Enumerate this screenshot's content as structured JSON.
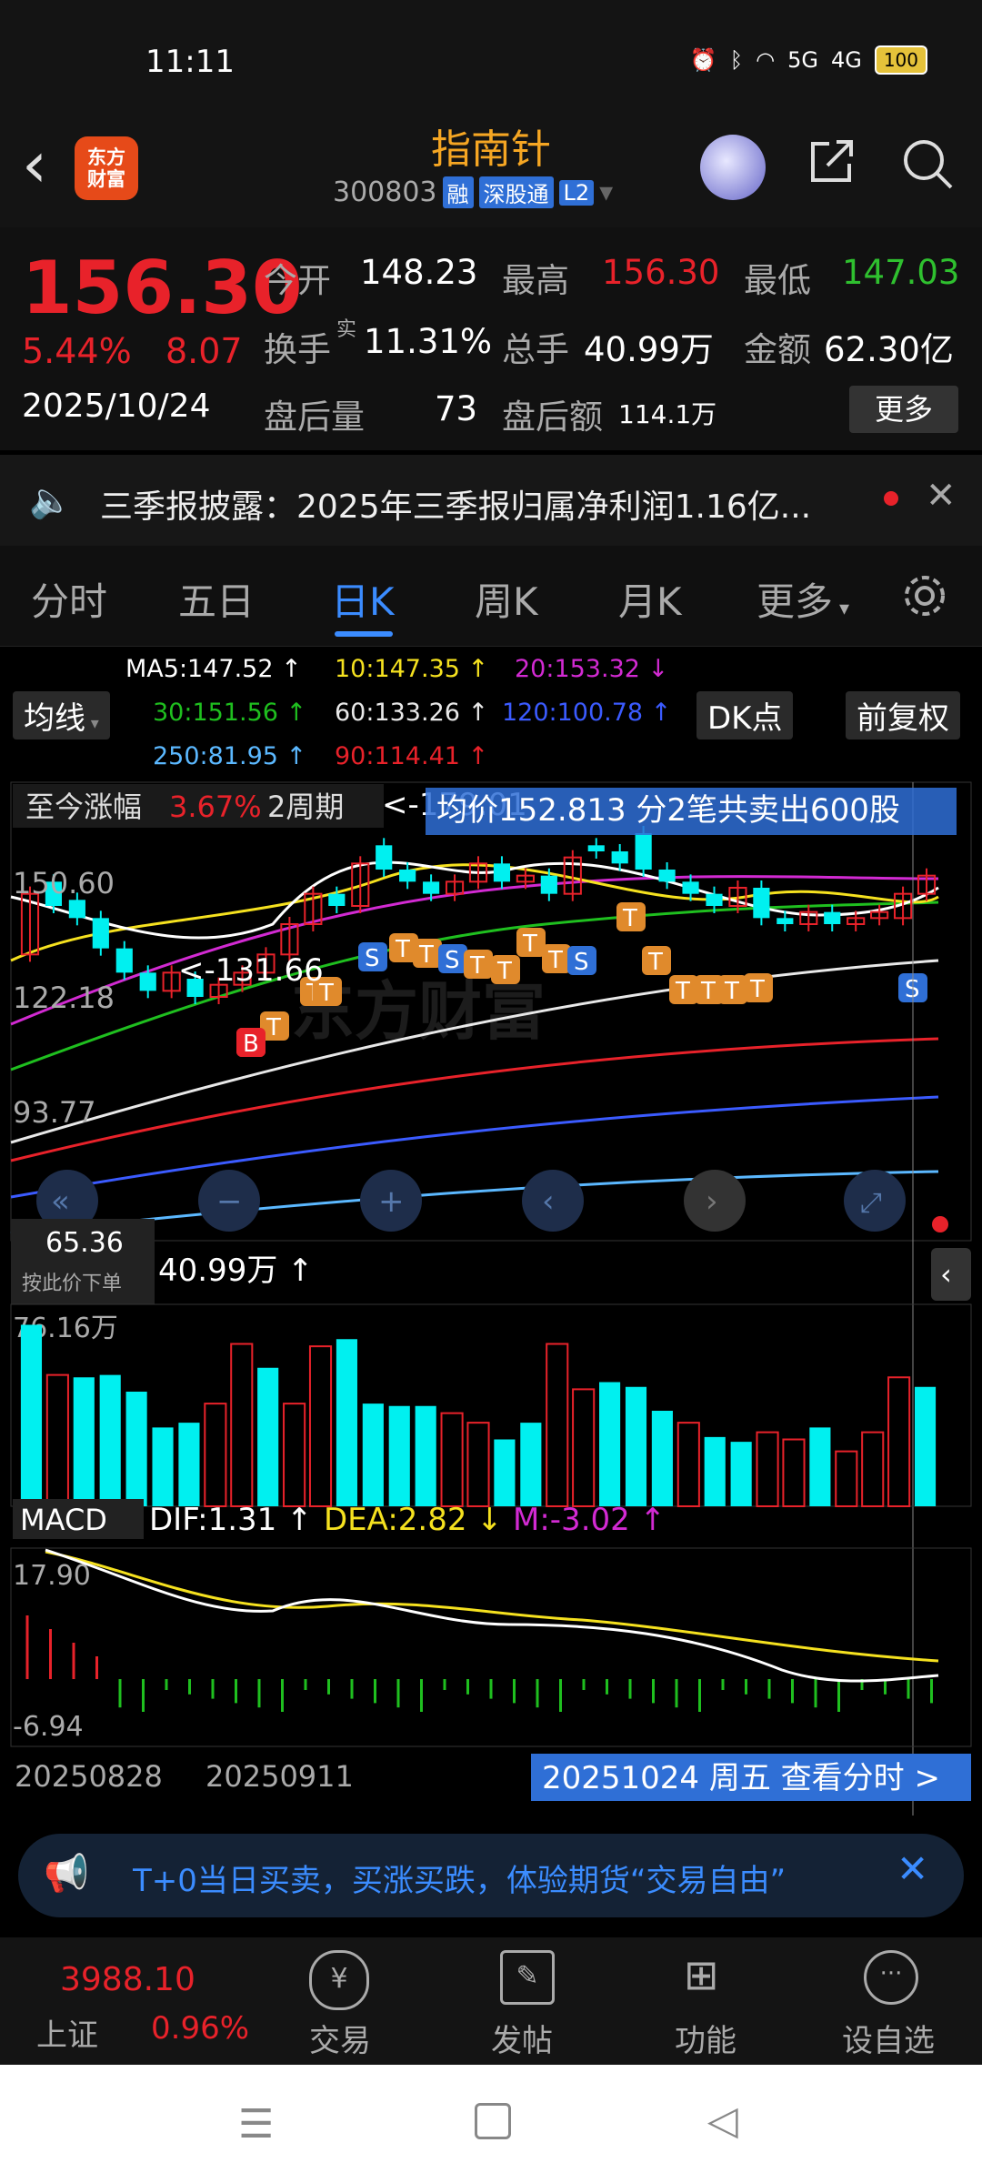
{
  "status_bar": {
    "time": "11:11",
    "network_5g": "5G",
    "network_4g": "4G",
    "battery": "100"
  },
  "header": {
    "logo_line1": "东方",
    "logo_line2": "财富",
    "stock_name": "指南针",
    "stock_code": "300803",
    "tags": [
      "融",
      "深股通",
      "L2"
    ]
  },
  "quote": {
    "price": "156.30",
    "change_pct": "5.44%",
    "change": "8.07",
    "date": "2025/10/24",
    "open_label": "今开",
    "open": "148.23",
    "high_label": "最高",
    "high": "156.30",
    "low_label": "最低",
    "low": "147.03",
    "turnover_label": "换手",
    "turnover_sup": "实",
    "turnover": "11.31%",
    "volume_label": "总手",
    "volume": "40.99万",
    "amount_label": "金额",
    "amount": "62.30亿",
    "after_vol_label": "盘后量",
    "after_vol": "73",
    "after_amt_label": "盘后额",
    "after_amt": "114.1万",
    "more_label": "更多"
  },
  "news": {
    "text": "三季报披露：2025年三季报归属净利润1.16亿..."
  },
  "tabs": [
    "分时",
    "五日",
    "日K",
    "周K",
    "月K",
    "更多"
  ],
  "active_tab": "日K",
  "chart": {
    "ma_button": "均线",
    "ma_values": {
      "ma5": "MA5:147.52 ↑",
      "ma10": "10:147.35 ↑",
      "ma20": "20:153.32 ↓",
      "ma30": "30:151.56 ↑",
      "ma60": "60:133.26 ↑",
      "ma120": "120:100.78 ↑",
      "ma250": "250:81.95 ↑",
      "ma90": "90:114.41 ↑"
    },
    "dk_button": "DK点",
    "adjust_button": "前复权",
    "gain_label": "至今涨幅",
    "gain_value": "3.67%",
    "period": "2周期",
    "high_mark": "<-179.01",
    "low_mark": "<-131.66",
    "avg_banner": "均价152.813  分2笔共卖出600股",
    "y_labels": [
      "150.60",
      "122.18",
      "93.77"
    ],
    "cursor_price": "65.36",
    "order_hint": "按此价下单",
    "volume_label": "40.99万 ↑",
    "volume_max": "76.16万",
    "macd_label": "MACD",
    "dif": "DIF:1.31 ↑",
    "dea": "DEA:2.82 ↓",
    "m": "M:-3.02 ↑",
    "macd_top": "17.90",
    "macd_bottom": "-6.94",
    "dates": [
      "20250828",
      "20250911"
    ],
    "view_link": "20251024 周五 查看分时 >",
    "colors": {
      "up": "#e8222a",
      "down": "#00f0f0",
      "ma5": "#ffffff",
      "ma10": "#f5e11f",
      "ma20": "#d22ad2",
      "ma30": "#1fbf1f",
      "ma60": "#e8e8e8",
      "ma90": "#e8222a",
      "ma120": "#3b5bff",
      "ma250": "#5bb8ff"
    }
  },
  "chart_data": {
    "type": "candlestick",
    "candles": [
      {
        "o": 140,
        "c": 150,
        "up": true
      },
      {
        "o": 152,
        "c": 148,
        "up": false
      },
      {
        "o": 149,
        "c": 146,
        "up": false
      },
      {
        "o": 146,
        "c": 141,
        "up": false
      },
      {
        "o": 141,
        "c": 137,
        "up": false
      },
      {
        "o": 137,
        "c": 134,
        "up": false
      },
      {
        "o": 134,
        "c": 137,
        "up": true
      },
      {
        "o": 136,
        "c": 133,
        "up": false
      },
      {
        "o": 133,
        "c": 135,
        "up": true
      },
      {
        "o": 135,
        "c": 137,
        "up": true
      },
      {
        "o": 137,
        "c": 140,
        "up": true
      },
      {
        "o": 140,
        "c": 145,
        "up": true
      },
      {
        "o": 145,
        "c": 150,
        "up": true
      },
      {
        "o": 150,
        "c": 148,
        "up": false
      },
      {
        "o": 148,
        "c": 155,
        "up": true
      },
      {
        "o": 158,
        "c": 154,
        "up": false
      },
      {
        "o": 154,
        "c": 152,
        "up": false
      },
      {
        "o": 152,
        "c": 150,
        "up": false
      },
      {
        "o": 150,
        "c": 152,
        "up": true
      },
      {
        "o": 152,
        "c": 155,
        "up": true
      },
      {
        "o": 155,
        "c": 152,
        "up": false
      },
      {
        "o": 152,
        "c": 153,
        "up": true
      },
      {
        "o": 153,
        "c": 150,
        "up": false
      },
      {
        "o": 150,
        "c": 156,
        "up": true
      },
      {
        "o": 158,
        "c": 157,
        "up": false
      },
      {
        "o": 157,
        "c": 155,
        "up": false
      },
      {
        "o": 160,
        "c": 154,
        "up": false
      },
      {
        "o": 154,
        "c": 152,
        "up": false
      },
      {
        "o": 152,
        "c": 150,
        "up": false
      },
      {
        "o": 150,
        "c": 148,
        "up": false
      },
      {
        "o": 148,
        "c": 151,
        "up": true
      },
      {
        "o": 151,
        "c": 146,
        "up": false
      },
      {
        "o": 146,
        "c": 145,
        "up": false
      },
      {
        "o": 145,
        "c": 147,
        "up": true
      },
      {
        "o": 147,
        "c": 145,
        "up": false
      },
      {
        "o": 145,
        "c": 146,
        "up": true
      },
      {
        "o": 146,
        "c": 147,
        "up": true
      },
      {
        "o": 146,
        "c": 150,
        "up": true
      },
      {
        "o": 150,
        "c": 153,
        "up": true
      }
    ],
    "volume": [
      76,
      55,
      54,
      55,
      48,
      33,
      35,
      43,
      68,
      58,
      43,
      67,
      70,
      43,
      42,
      42,
      39,
      35,
      28,
      35,
      68,
      49,
      52,
      50,
      40,
      35,
      29,
      27,
      31,
      28,
      33,
      23,
      31,
      54,
      50
    ],
    "volume_up": [
      false,
      true,
      false,
      false,
      false,
      false,
      false,
      true,
      true,
      false,
      true,
      true,
      false,
      false,
      false,
      false,
      true,
      true,
      false,
      false,
      true,
      true,
      false,
      false,
      false,
      true,
      false,
      false,
      true,
      true,
      false,
      true,
      true,
      true,
      false
    ],
    "signals": [
      "B",
      "T",
      "T",
      "T",
      "S",
      "T",
      "T",
      "S",
      "T",
      "T",
      "T",
      "T",
      "S",
      "T",
      "T",
      "T",
      "T",
      "T",
      "T",
      "B",
      "S"
    ]
  },
  "ad": {
    "text": "T+0当日买卖，买涨买跌，体验期货“交易自由”"
  },
  "bottom_bar": {
    "index_value": "3988.10",
    "index_name": "上证",
    "index_pct": "0.96%",
    "items": [
      "交易",
      "发帖",
      "功能",
      "设自选"
    ]
  }
}
